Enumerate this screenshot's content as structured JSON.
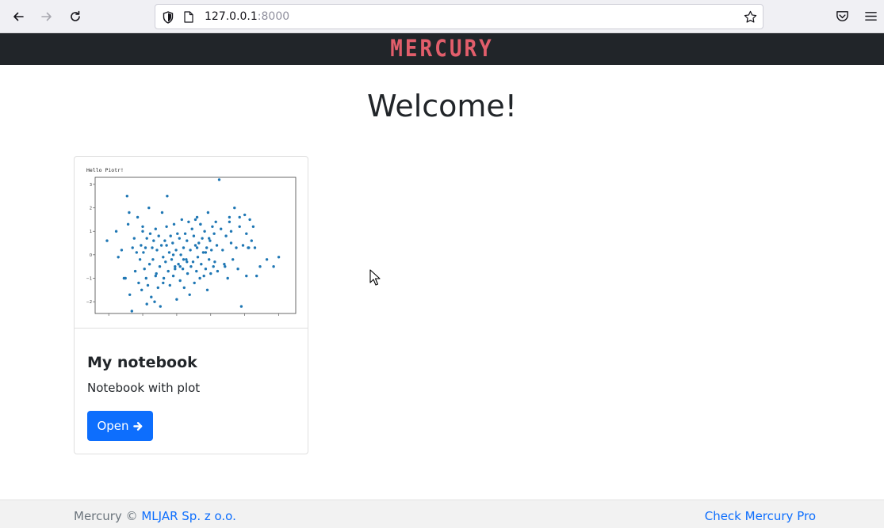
{
  "browser": {
    "url_host": "127.0.0.1",
    "url_port": ":8000"
  },
  "header": {
    "logo_text": "MERCURY",
    "logo_color": "#e25e6b",
    "background": "#212529"
  },
  "main": {
    "title": "Welcome!"
  },
  "card": {
    "title": "My notebook",
    "description": "Notebook with plot",
    "button_label": "Open",
    "button_icon": "arrow-right-icon",
    "button_color": "#0d6efd"
  },
  "footer": {
    "copyright_prefix": "Mercury ©",
    "company_link": "MLJAR Sp. z o.o.",
    "pro_link": "Check Mercury Pro"
  },
  "chart_data": {
    "type": "scatter",
    "title": "Hello Piotr!",
    "xlabel": "",
    "ylabel": "",
    "xlim": [
      -2.4,
      3.5
    ],
    "ylim": [
      -2.5,
      3.3
    ],
    "yticks": [
      "3",
      "2",
      "1",
      "0",
      "−1",
      "−2"
    ],
    "grid": false,
    "color": "#1f77b4",
    "x": [
      -2.05,
      -1.78,
      -1.72,
      -1.62,
      -1.55,
      -1.51,
      -1.46,
      -1.43,
      -1.38,
      -1.32,
      -1.3,
      -1.25,
      -1.22,
      -1.18,
      -1.15,
      -1.12,
      -1.08,
      -1.05,
      -1.03,
      -1.0,
      -0.98,
      -0.95,
      -0.92,
      -0.9,
      -0.88,
      -0.85,
      -0.82,
      -0.8,
      -0.78,
      -0.75,
      -0.72,
      -0.7,
      -0.68,
      -0.65,
      -0.62,
      -0.6,
      -0.58,
      -0.55,
      -0.53,
      -0.5,
      -0.48,
      -0.45,
      -0.43,
      -0.4,
      -0.38,
      -0.35,
      -0.33,
      -0.3,
      -0.28,
      -0.25,
      -0.22,
      -0.2,
      -0.18,
      -0.15,
      -0.12,
      -0.1,
      -0.08,
      -0.05,
      -0.02,
      0.0,
      0.02,
      0.05,
      0.08,
      0.1,
      0.12,
      0.15,
      0.18,
      0.2,
      0.22,
      0.25,
      0.28,
      0.3,
      0.32,
      0.35,
      0.38,
      0.4,
      0.42,
      0.45,
      0.48,
      0.5,
      0.52,
      0.55,
      0.58,
      0.6,
      0.62,
      0.65,
      0.68,
      0.7,
      0.72,
      0.75,
      0.78,
      0.8,
      0.82,
      0.85,
      0.88,
      0.9,
      0.92,
      0.95,
      0.98,
      1.0,
      1.02,
      1.05,
      1.08,
      1.1,
      1.12,
      1.15,
      1.18,
      1.2,
      1.25,
      1.3,
      1.35,
      1.4,
      1.45,
      1.5,
      1.55,
      1.6,
      1.65,
      1.7,
      1.75,
      1.8,
      1.85,
      1.9,
      1.95,
      2.0,
      2.05,
      2.1,
      2.15,
      2.2,
      2.25,
      2.3,
      2.35,
      2.45,
      2.65,
      2.85,
      3.0,
      1.42,
      1.55,
      1.6,
      -1.4,
      -1.0,
      -0.4,
      0.1,
      -0.1,
      0.6,
      0.95,
      0.55,
      -0.05,
      -0.62,
      -0.88,
      1.85,
      2.05,
      2.12,
      0.2,
      0.3,
      -0.3,
      0.7,
      0.85,
      1.0
    ],
    "y": [
      0.6,
      1.0,
      -0.1,
      0.2,
      -1.0,
      -1.0,
      2.5,
      1.3,
      -1.7,
      -2.4,
      0.3,
      0.7,
      -0.7,
      0.1,
      1.6,
      -1.2,
      -0.2,
      0.4,
      -1.5,
      1.0,
      0.1,
      -0.6,
      0.3,
      -1.0,
      0.7,
      -1.3,
      2.0,
      -0.4,
      0.9,
      -1.8,
      0.3,
      -0.2,
      0.6,
      -2.0,
      1.1,
      -0.8,
      0.2,
      -1.4,
      0.8,
      -0.5,
      -2.2,
      0.4,
      1.8,
      -0.1,
      -1.0,
      0.6,
      -0.3,
      1.2,
      2.5,
      -0.7,
      0.1,
      -1.3,
      0.8,
      -0.2,
      0.5,
      -0.9,
      1.3,
      -0.5,
      0.2,
      -1.9,
      0.9,
      -0.4,
      0.7,
      -1.1,
      0.0,
      1.5,
      -0.6,
      0.3,
      -1.4,
      0.9,
      -0.2,
      0.6,
      -0.8,
      1.4,
      -1.7,
      0.2,
      -0.5,
      1.1,
      -0.3,
      0.8,
      -1.2,
      0.4,
      -0.7,
      1.6,
      -0.1,
      0.5,
      -1.0,
      1.3,
      -0.4,
      0.7,
      0.1,
      -0.9,
      1.0,
      -0.6,
      0.3,
      -1.5,
      1.8,
      -0.2,
      0.6,
      -0.8,
      0.2,
      1.2,
      -0.5,
      0.9,
      -0.3,
      1.4,
      0.4,
      -0.7,
      3.2,
      1.1,
      0.2,
      -0.4,
      0.8,
      -1.0,
      1.6,
      0.5,
      -0.2,
      2.0,
      0.3,
      -0.6,
      1.2,
      -2.2,
      0.4,
      1.7,
      -0.9,
      0.3,
      1.5,
      0.6,
      1.2,
      0.3,
      -0.9,
      -0.5,
      -0.2,
      -0.5,
      -0.1,
      -0.5,
      1.4,
      1.0,
      1.8,
      1.2,
      -1.2,
      -0.5,
      0.0,
      0.3,
      0.7,
      1.5,
      -0.6,
      -0.9,
      -2.1,
      1.6,
      0.9,
      0.3,
      -0.2,
      -0.3,
      0.4,
      1.3,
      0.1
    ]
  }
}
